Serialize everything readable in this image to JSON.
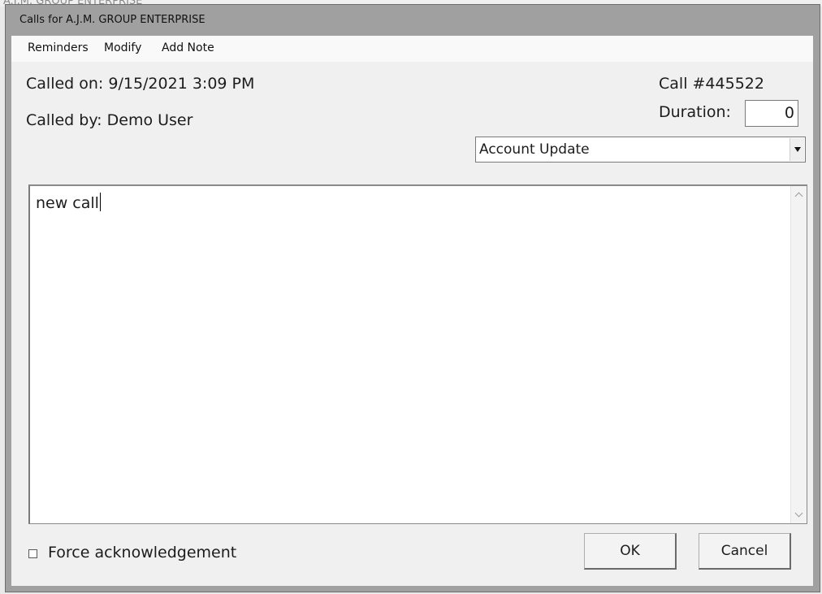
{
  "background_window": {
    "title": "A.J.M. GROUP ENTERPRISE"
  },
  "dialog": {
    "title": "Calls for A.J.M. GROUP ENTERPRISE",
    "menu": [
      "Reminders",
      "Modify",
      "Add Note"
    ],
    "called_on": "Called on: 9/15/2021 3:09 PM",
    "called_by": "Called by: Demo User",
    "call_number": "Call #445522",
    "duration_label": "Duration:",
    "duration_value": "0",
    "call_type": "Account Update",
    "note_text": "new call",
    "force_ack_label": "Force acknowledgement",
    "force_ack_checked": false,
    "ok_label": "OK",
    "cancel_label": "Cancel"
  },
  "icons": [
    "chevron-down-icon",
    "scroll-up-icon",
    "scroll-down-icon"
  ],
  "colors": {
    "frame": "#a0a0a0",
    "client": "#f0f0f0",
    "menubar": "#f9f9f9"
  }
}
